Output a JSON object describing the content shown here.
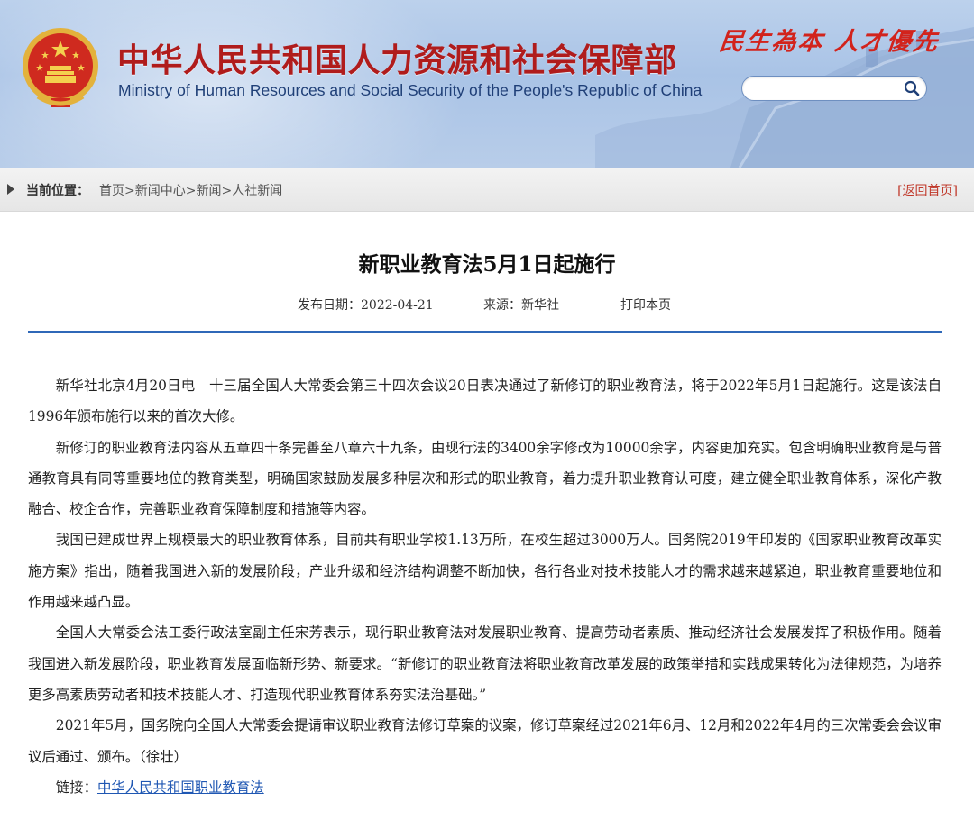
{
  "header": {
    "title": "中华人民共和国人力资源和社会保障部",
    "subtitle": "Ministry of Human Resources and Social Security of the People's Republic of China",
    "slogan": "民生為本 人才優先",
    "search": {
      "value": "",
      "placeholder": ""
    },
    "colors": {
      "title": "#b01c1c",
      "subtitle": "#1f3f77",
      "slogan": "#d2231c"
    }
  },
  "breadcrumb": {
    "label": "当前位置：",
    "items": [
      "首页",
      "新闻中心",
      "新闻",
      "人社新闻"
    ],
    "separator": ">",
    "home_link": "[返回首页]"
  },
  "article": {
    "title": "新职业教育法5月1日起施行",
    "date": "发布日期：2022-04-21",
    "source": "来源：新华社",
    "print": "打印本页",
    "paragraphs": [
      "新华社北京4月20日电　十三届全国人大常委会第三十四次会议20日表决通过了新修订的职业教育法，将于2022年5月1日起施行。这是该法自1996年颁布施行以来的首次大修。",
      "新修订的职业教育法内容从五章四十条完善至八章六十九条，由现行法的3400余字修改为10000余字，内容更加充实。包含明确职业教育是与普通教育具有同等重要地位的教育类型，明确国家鼓励发展多种层次和形式的职业教育，着力提升职业教育认可度，建立健全职业教育体系，深化产教融合、校企合作，完善职业教育保障制度和措施等内容。",
      "我国已建成世界上规模最大的职业教育体系，目前共有职业学校1.13万所，在校生超过3000万人。国务院2019年印发的《国家职业教育改革实施方案》指出，随着我国进入新的发展阶段，产业升级和经济结构调整不断加快，各行各业对技术技能人才的需求越来越紧迫，职业教育重要地位和作用越来越凸显。",
      "全国人大常委会法工委行政法室副主任宋芳表示，现行职业教育法对发展职业教育、提高劳动者素质、推动经济社会发展发挥了积极作用。随着我国进入新发展阶段，职业教育发展面临新形势、新要求。“新修订的职业教育法将职业教育改革发展的政策举措和实践成果转化为法律规范，为培养更多高素质劳动者和技术技能人才、打造现代职业教育体系夯实法治基础。”",
      "2021年5月，国务院向全国人大常委会提请审议职业教育法修订草案的议案，修订草案经过2021年6月、12月和2022年4月的三次常委会会议审议后通过、颁布。（徐壮）"
    ],
    "link_label": "链接：",
    "link_text": "中华人民共和国职业教育法",
    "colors": {
      "rule": "#2f68b8",
      "link": "#1f57b3"
    }
  }
}
